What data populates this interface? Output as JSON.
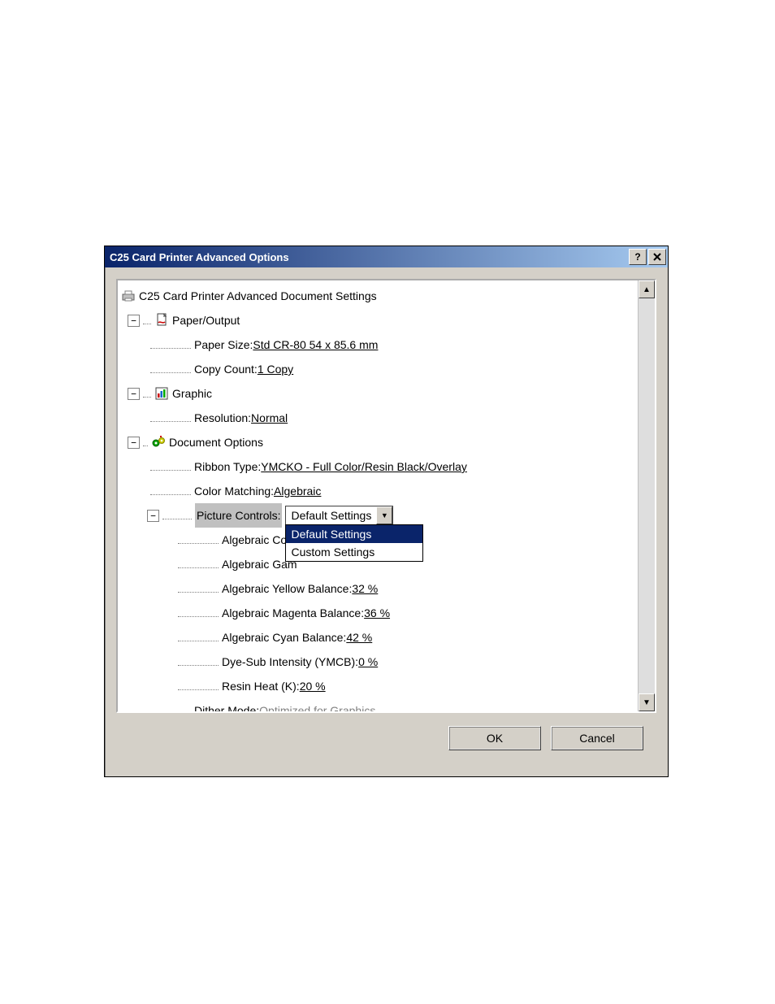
{
  "title": "C25 Card Printer Advanced Options",
  "tree": {
    "root": "C25 Card Printer Advanced Document Settings",
    "paper_output": "Paper/Output",
    "paper_size_label": "Paper Size: ",
    "paper_size_value": "Std CR-80  54 x 85.6 mm",
    "copy_count_label": "Copy Count: ",
    "copy_count_value": "1 Copy",
    "graphic": "Graphic",
    "resolution_label": "Resolution: ",
    "resolution_value": "Normal",
    "doc_options": "Document Options",
    "ribbon_label": "Ribbon Type: ",
    "ribbon_value": "YMCKO - Full Color/Resin Black/Overlay",
    "color_matching_label": "Color Matching: ",
    "color_matching_value": "Algebraic",
    "picture_controls_label": "Picture Controls: ",
    "picture_controls_selected": "Default Settings",
    "dd_option_default": "Default Settings",
    "dd_option_custom": "Custom Settings",
    "alg_contrast_label": "Algebraic Cont",
    "alg_gamma_label": "Algebraic Gam",
    "alg_yellow_label": "Algebraic Yellow Balance: ",
    "alg_yellow_value": "32 %",
    "alg_magenta_label": "Algebraic Magenta Balance: ",
    "alg_magenta_value": "36 %",
    "alg_cyan_label": "Algebraic Cyan Balance: ",
    "alg_cyan_value": "42 %",
    "dye_sub_label": "Dye-Sub Intensity (YMCB): ",
    "dye_sub_value": "0 %",
    "resin_heat_label": "Resin Heat (K): ",
    "resin_heat_value": "20 %",
    "dither_label": "Dither Mode: ",
    "dither_value": "Optimized for Graphics"
  },
  "buttons": {
    "ok": "OK",
    "cancel": "Cancel"
  }
}
